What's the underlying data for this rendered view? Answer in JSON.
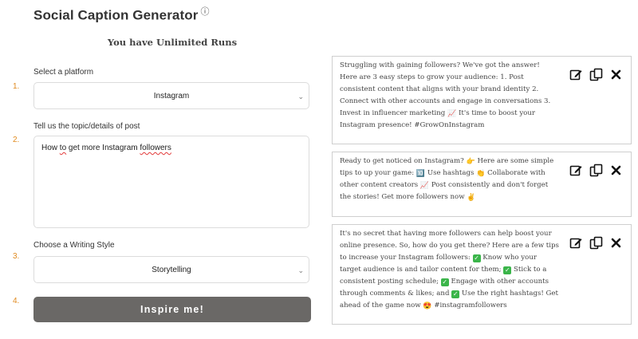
{
  "app": {
    "title": "Social Caption Generator",
    "info_icon": "ⓘ",
    "runs_text": "You have Unlimited Runs"
  },
  "form": {
    "steps": [
      "1.",
      "2.",
      "3.",
      "4."
    ],
    "platform_label": "Select a platform",
    "platform_value": "Instagram",
    "topic_label": "Tell us the topic/details of post",
    "topic_parts": [
      "How ",
      "to",
      " get more Instagram ",
      "followers"
    ],
    "style_label": "Choose a Writing Style",
    "style_value": "Storytelling",
    "submit_label": "Inspire me!"
  },
  "results": [
    {
      "parts": [
        "Struggling with gaining followers? We've got the answer! Here are 3 easy steps to grow your audience: 1. Post consistent content that aligns with your brand identity 2. Connect with other accounts and engage in conversations 3. Invest in influencer marketing ",
        "📈",
        " It's time to boost your Instagram presence! #GrowOnInstagram"
      ]
    },
    {
      "parts": [
        "Ready to get noticed on Instagram? ",
        "👉",
        " Here are some simple tips to up your game: ",
        "🔟",
        " Use hashtags ",
        "👏",
        " Collaborate with other content creators ",
        "📈",
        " Post consistently and don't forget the stories! Get more followers now ",
        "✌"
      ]
    },
    {
      "parts": [
        "It's no secret that having more followers can help boost your online presence. So, how do you get there? Here are a few tips  to increase your Instagram followers: ",
        "✓",
        " Know who your target audience is and tailor content for them; ",
        "✓",
        " Stick to a consistent posting schedule; ",
        "✓",
        " Engage with other accounts through comments & likes; and ",
        "✓",
        " Use the right hashtags! Get ahead of the game now ",
        "😍",
        " #instagramfollowers"
      ]
    }
  ],
  "icons": {
    "edit": "edit-icon",
    "copy": "copy-icon",
    "close": "close-icon",
    "chevron": "chevron-down-icon"
  },
  "colors": {
    "step_number": "#e08a1e",
    "button_bg": "#6a6866",
    "check_green": "#3bb54a",
    "spell_error": "#e23a3a"
  }
}
